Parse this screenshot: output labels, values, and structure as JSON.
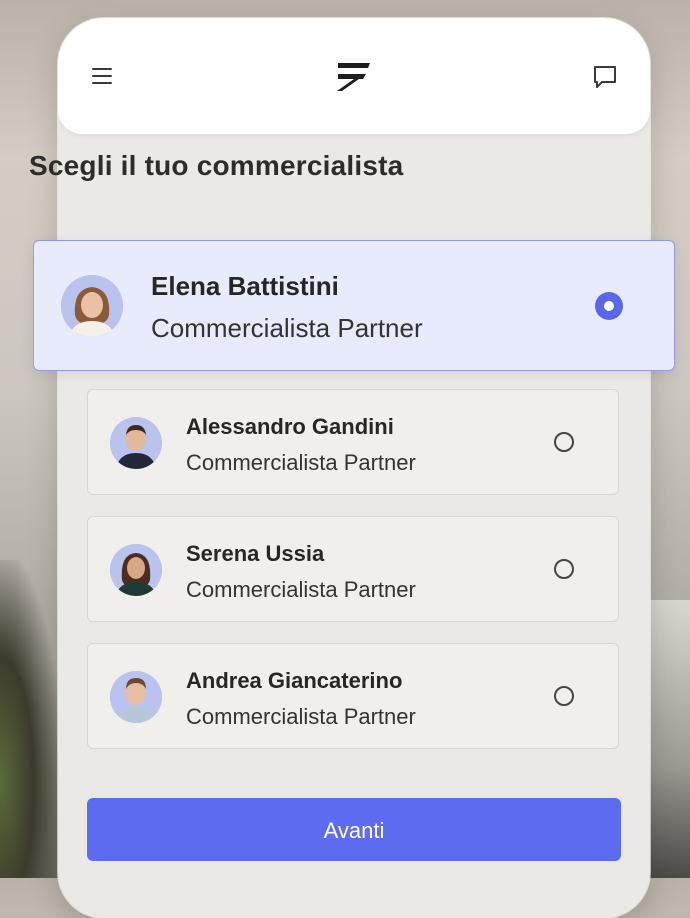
{
  "header": {
    "menu_icon": "hamburger-menu-icon",
    "logo_icon": "brand-logo-icon",
    "chat_icon": "chat-bubble-icon"
  },
  "page": {
    "title": "Scegli il tuo commercialista"
  },
  "advisors": [
    {
      "name": "Elena Battistini",
      "role": "Commercialista Partner",
      "selected": true
    },
    {
      "name": "Alessandro Gandini",
      "role": "Commercialista Partner",
      "selected": false
    },
    {
      "name": "Serena Ussia",
      "role": "Commercialista Partner",
      "selected": false
    },
    {
      "name": "Andrea Giancaterino",
      "role": "Commercialista Partner",
      "selected": false
    }
  ],
  "actions": {
    "next_label": "Avanti"
  },
  "colors": {
    "accent": "#5c6bf0",
    "selected_bg": "#e7ebfb",
    "selected_border": "#8f9ae6"
  }
}
